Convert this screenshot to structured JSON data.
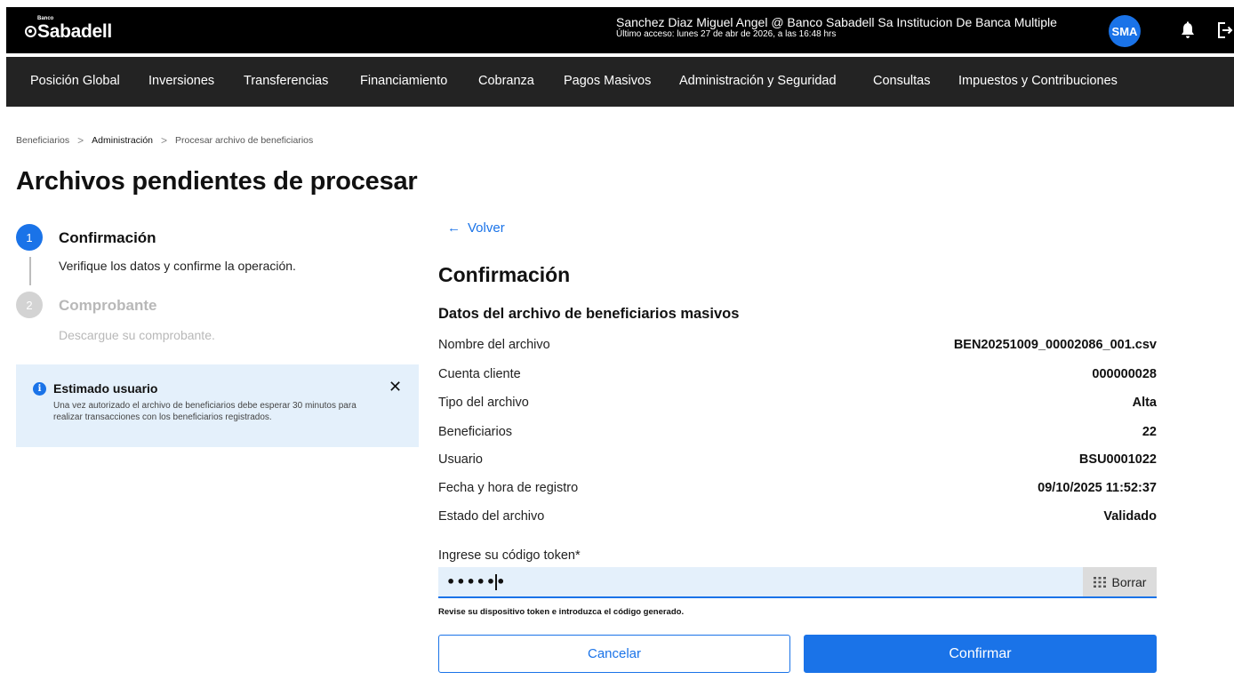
{
  "header": {
    "logo_small": "Banco",
    "logo_text": "Sabadell",
    "user_name": "Sanchez Diaz Miguel Angel @ Banco Sabadell Sa Institucion De Banca Multiple",
    "last_access": "Último acceso: lunes 27 de abr de 2026, a las 16:48 hrs",
    "avatar_initials": "SMA",
    "avatar_color": "#1a73e8"
  },
  "nav": {
    "items": [
      {
        "label": "Posición Global"
      },
      {
        "label": "Inversiones"
      },
      {
        "label": "Transferencias"
      },
      {
        "label": "Financiamiento"
      },
      {
        "label": "Cobranza"
      },
      {
        "label": "Pagos Masivos"
      },
      {
        "label": "Administración y Seguridad"
      },
      {
        "label": "Consultas"
      },
      {
        "label": "Impuestos y Contribuciones"
      }
    ]
  },
  "breadcrumb": {
    "items": [
      "Beneficiarios",
      "Administración",
      "Procesar archivo de beneficiarios"
    ]
  },
  "page_title": "Archivos pendientes de procesar",
  "stepper": {
    "steps": [
      {
        "number": "1",
        "title": "Confirmación",
        "description": "Verifique los datos y confirme la operación.",
        "state": "active"
      },
      {
        "number": "2",
        "title": "Comprobante",
        "description": "Descargue su comprobante.",
        "state": "pending"
      }
    ]
  },
  "info": {
    "title": "Estimado usuario",
    "text": "Una vez autorizado el archivo de beneficiarios debe esperar 30 minutos para realizar transacciones con los beneficiarios registrados.",
    "close": "✕"
  },
  "main": {
    "back_label": "Volver",
    "section_title": "Confirmación",
    "subsection_title": "Datos del archivo de beneficiarios masivos",
    "rows": [
      {
        "label": "Nombre del archivo",
        "value": "BEN20251009_00002086_001.csv"
      },
      {
        "label": "Cuenta cliente",
        "value": "000000028"
      },
      {
        "label": "Tipo del archivo",
        "value": "Alta"
      },
      {
        "label": "Beneficiarios",
        "value": "22"
      },
      {
        "label": "Usuario",
        "value": "BSU0001022"
      },
      {
        "label": "Fecha y hora de registro",
        "value": "09/10/2025 11:52:37"
      },
      {
        "label": "Estado del archivo",
        "value": "Validado"
      }
    ],
    "token": {
      "label": "Ingrese su código token*",
      "value": "••••••",
      "clear_label": "Borrar",
      "help": "Revise su dispositivo token e introduzca el código generado."
    },
    "cancel_label": "Cancelar",
    "confirm_label": "Confirmar"
  },
  "colors": {
    "accent": "#1a73e8",
    "topbar": "#000000",
    "navbar": "#232323",
    "info_bg": "#e4f0fb"
  },
  "icons": [
    "bell-icon",
    "logout-icon",
    "info-icon",
    "close-icon",
    "keypad-icon",
    "arrow-left-icon",
    "chevron-right-icon"
  ]
}
